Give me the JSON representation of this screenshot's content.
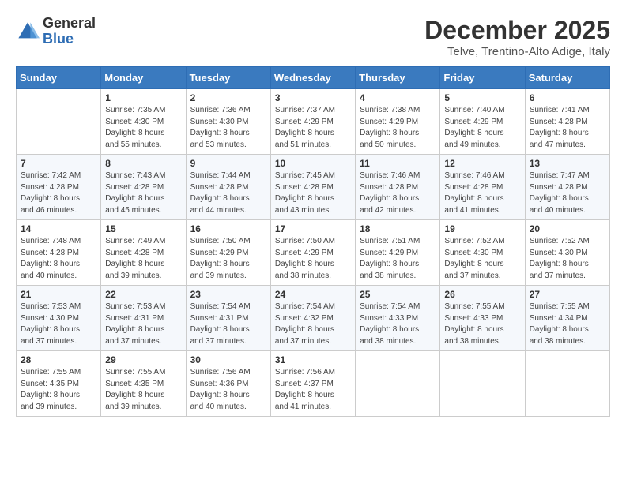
{
  "header": {
    "logo_general": "General",
    "logo_blue": "Blue",
    "month_year": "December 2025",
    "location": "Telve, Trentino-Alto Adige, Italy"
  },
  "weekdays": [
    "Sunday",
    "Monday",
    "Tuesday",
    "Wednesday",
    "Thursday",
    "Friday",
    "Saturday"
  ],
  "weeks": [
    [
      {
        "day": "",
        "detail": ""
      },
      {
        "day": "1",
        "detail": "Sunrise: 7:35 AM\nSunset: 4:30 PM\nDaylight: 8 hours\nand 55 minutes."
      },
      {
        "day": "2",
        "detail": "Sunrise: 7:36 AM\nSunset: 4:30 PM\nDaylight: 8 hours\nand 53 minutes."
      },
      {
        "day": "3",
        "detail": "Sunrise: 7:37 AM\nSunset: 4:29 PM\nDaylight: 8 hours\nand 51 minutes."
      },
      {
        "day": "4",
        "detail": "Sunrise: 7:38 AM\nSunset: 4:29 PM\nDaylight: 8 hours\nand 50 minutes."
      },
      {
        "day": "5",
        "detail": "Sunrise: 7:40 AM\nSunset: 4:29 PM\nDaylight: 8 hours\nand 49 minutes."
      },
      {
        "day": "6",
        "detail": "Sunrise: 7:41 AM\nSunset: 4:28 PM\nDaylight: 8 hours\nand 47 minutes."
      }
    ],
    [
      {
        "day": "7",
        "detail": "Sunrise: 7:42 AM\nSunset: 4:28 PM\nDaylight: 8 hours\nand 46 minutes."
      },
      {
        "day": "8",
        "detail": "Sunrise: 7:43 AM\nSunset: 4:28 PM\nDaylight: 8 hours\nand 45 minutes."
      },
      {
        "day": "9",
        "detail": "Sunrise: 7:44 AM\nSunset: 4:28 PM\nDaylight: 8 hours\nand 44 minutes."
      },
      {
        "day": "10",
        "detail": "Sunrise: 7:45 AM\nSunset: 4:28 PM\nDaylight: 8 hours\nand 43 minutes."
      },
      {
        "day": "11",
        "detail": "Sunrise: 7:46 AM\nSunset: 4:28 PM\nDaylight: 8 hours\nand 42 minutes."
      },
      {
        "day": "12",
        "detail": "Sunrise: 7:46 AM\nSunset: 4:28 PM\nDaylight: 8 hours\nand 41 minutes."
      },
      {
        "day": "13",
        "detail": "Sunrise: 7:47 AM\nSunset: 4:28 PM\nDaylight: 8 hours\nand 40 minutes."
      }
    ],
    [
      {
        "day": "14",
        "detail": "Sunrise: 7:48 AM\nSunset: 4:28 PM\nDaylight: 8 hours\nand 40 minutes."
      },
      {
        "day": "15",
        "detail": "Sunrise: 7:49 AM\nSunset: 4:28 PM\nDaylight: 8 hours\nand 39 minutes."
      },
      {
        "day": "16",
        "detail": "Sunrise: 7:50 AM\nSunset: 4:29 PM\nDaylight: 8 hours\nand 39 minutes."
      },
      {
        "day": "17",
        "detail": "Sunrise: 7:50 AM\nSunset: 4:29 PM\nDaylight: 8 hours\nand 38 minutes."
      },
      {
        "day": "18",
        "detail": "Sunrise: 7:51 AM\nSunset: 4:29 PM\nDaylight: 8 hours\nand 38 minutes."
      },
      {
        "day": "19",
        "detail": "Sunrise: 7:52 AM\nSunset: 4:30 PM\nDaylight: 8 hours\nand 37 minutes."
      },
      {
        "day": "20",
        "detail": "Sunrise: 7:52 AM\nSunset: 4:30 PM\nDaylight: 8 hours\nand 37 minutes."
      }
    ],
    [
      {
        "day": "21",
        "detail": "Sunrise: 7:53 AM\nSunset: 4:30 PM\nDaylight: 8 hours\nand 37 minutes."
      },
      {
        "day": "22",
        "detail": "Sunrise: 7:53 AM\nSunset: 4:31 PM\nDaylight: 8 hours\nand 37 minutes."
      },
      {
        "day": "23",
        "detail": "Sunrise: 7:54 AM\nSunset: 4:31 PM\nDaylight: 8 hours\nand 37 minutes."
      },
      {
        "day": "24",
        "detail": "Sunrise: 7:54 AM\nSunset: 4:32 PM\nDaylight: 8 hours\nand 37 minutes."
      },
      {
        "day": "25",
        "detail": "Sunrise: 7:54 AM\nSunset: 4:33 PM\nDaylight: 8 hours\nand 38 minutes."
      },
      {
        "day": "26",
        "detail": "Sunrise: 7:55 AM\nSunset: 4:33 PM\nDaylight: 8 hours\nand 38 minutes."
      },
      {
        "day": "27",
        "detail": "Sunrise: 7:55 AM\nSunset: 4:34 PM\nDaylight: 8 hours\nand 38 minutes."
      }
    ],
    [
      {
        "day": "28",
        "detail": "Sunrise: 7:55 AM\nSunset: 4:35 PM\nDaylight: 8 hours\nand 39 minutes."
      },
      {
        "day": "29",
        "detail": "Sunrise: 7:55 AM\nSunset: 4:35 PM\nDaylight: 8 hours\nand 39 minutes."
      },
      {
        "day": "30",
        "detail": "Sunrise: 7:56 AM\nSunset: 4:36 PM\nDaylight: 8 hours\nand 40 minutes."
      },
      {
        "day": "31",
        "detail": "Sunrise: 7:56 AM\nSunset: 4:37 PM\nDaylight: 8 hours\nand 41 minutes."
      },
      {
        "day": "",
        "detail": ""
      },
      {
        "day": "",
        "detail": ""
      },
      {
        "day": "",
        "detail": ""
      }
    ]
  ]
}
